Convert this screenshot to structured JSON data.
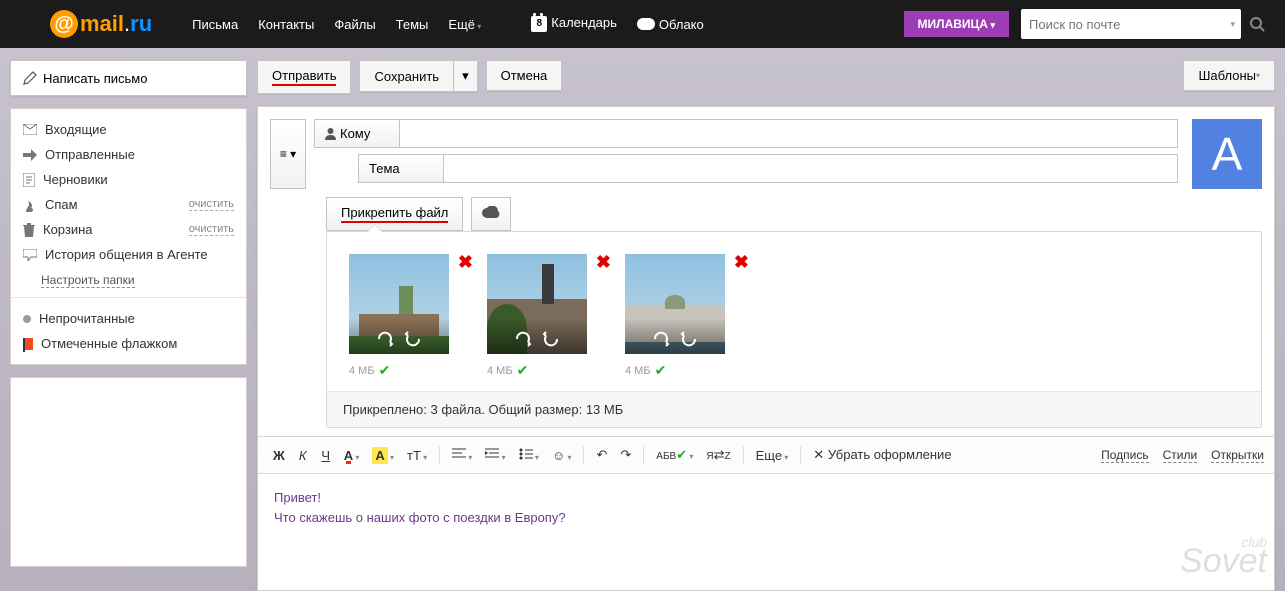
{
  "header": {
    "nav": [
      "Письма",
      "Контакты",
      "Файлы",
      "Темы",
      "Ещё"
    ],
    "calendar": "Календарь",
    "calendar_day": "8",
    "cloud": "Облако",
    "user": "МИЛАВИЦА",
    "search_placeholder": "Поиск по почте"
  },
  "sidebar": {
    "compose": "Написать письмо",
    "folders": [
      {
        "icon": "inbox",
        "label": "Входящие"
      },
      {
        "icon": "sent",
        "label": "Отправленные"
      },
      {
        "icon": "draft",
        "label": "Черновики"
      },
      {
        "icon": "spam",
        "label": "Спам",
        "clear": "очистить"
      },
      {
        "icon": "trash",
        "label": "Корзина",
        "clear": "очистить"
      },
      {
        "icon": "agent",
        "label": "История общения в Агенте"
      }
    ],
    "configure": "Настроить папки",
    "unread": "Непрочитанные",
    "flagged": "Отмеченные флажком"
  },
  "toolbar": {
    "send": "Отправить",
    "save": "Сохранить",
    "cancel": "Отмена",
    "templates": "Шаблоны"
  },
  "compose": {
    "to_label": "Кому",
    "subject_label": "Тема",
    "attach": "Прикрепить файл",
    "avatar_initial": "А"
  },
  "attachments": {
    "items": [
      {
        "size": "4 МБ"
      },
      {
        "size": "4 МБ"
      },
      {
        "size": "4 МБ"
      }
    ],
    "summary": "Прикреплено: 3 файла. Общий размер: 13 МБ"
  },
  "editor": {
    "b": "Ж",
    "i": "К",
    "u": "Ч",
    "a": "А",
    "bg": "А",
    "tt": "тТ",
    "more": "Еще",
    "clear_fmt": "Убрать оформление",
    "links": [
      "Подпись",
      "Стили",
      "Открытки"
    ]
  },
  "body": {
    "line1": "Привет!",
    "line2": "Что скажешь о наших фото с поездки в Европу?"
  },
  "watermark": {
    "small": "club",
    "big": "Sovet"
  }
}
